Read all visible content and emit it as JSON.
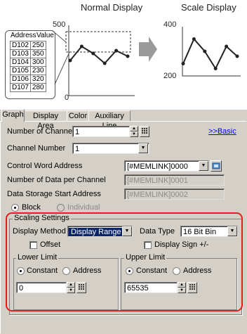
{
  "illustration": {
    "normal_title": "Normal Display",
    "scale_title": "Scale Display",
    "table_headers": [
      "Address",
      "Value"
    ],
    "rows": [
      {
        "address": "D102",
        "value": "250"
      },
      {
        "address": "D103",
        "value": "350"
      },
      {
        "address": "D104",
        "value": "300"
      },
      {
        "address": "D105",
        "value": "230"
      },
      {
        "address": "D106",
        "value": "320"
      },
      {
        "address": "D107",
        "value": "280"
      }
    ],
    "normal_axis": {
      "top": "500",
      "bottom": "0"
    },
    "scale_axis": {
      "top": "400",
      "bottom": "200"
    }
  },
  "chart_data": [
    {
      "type": "line",
      "title": "Normal Display",
      "x": [
        1,
        2,
        3,
        4,
        5,
        6
      ],
      "values": [
        250,
        350,
        300,
        230,
        320,
        280
      ],
      "ylim": [
        0,
        500
      ]
    },
    {
      "type": "line",
      "title": "Scale Display",
      "x": [
        1,
        2,
        3,
        4,
        5,
        6
      ],
      "values": [
        250,
        350,
        300,
        230,
        320,
        280
      ],
      "ylim": [
        200,
        400
      ]
    }
  ],
  "tabs": [
    "Graph",
    "Display Area",
    "Color",
    "Auxiliary Line"
  ],
  "form": {
    "num_channels_label": "Number of Channels",
    "num_channels_value": "1",
    "basic_link": ">>Basic",
    "channel_number_label": "Channel Number",
    "channel_number_value": "1",
    "control_word_label": "Control Word Address",
    "control_word_value": "[#MEMLINK]0000",
    "num_data_label": "Number of Data per Channel",
    "num_data_value": "[#MEMLINK]0001",
    "storage_label": "Data Storage Start Address",
    "storage_value": "[#MEMLINK]0002",
    "block_label": "Block",
    "individual_label": "Individual"
  },
  "scaling": {
    "title": "Scaling Settings",
    "display_method_label": "Display Method",
    "display_method_value": "Display Range",
    "data_type_label": "Data Type",
    "data_type_value": "16 Bit Bin",
    "offset_label": "Offset",
    "display_sign_label": "Display Sign +/-",
    "lower": {
      "title": "Lower Limit",
      "constant": "Constant",
      "address": "Address",
      "value": "0"
    },
    "upper": {
      "title": "Upper Limit",
      "constant": "Constant",
      "address": "Address",
      "value": "65535"
    }
  }
}
